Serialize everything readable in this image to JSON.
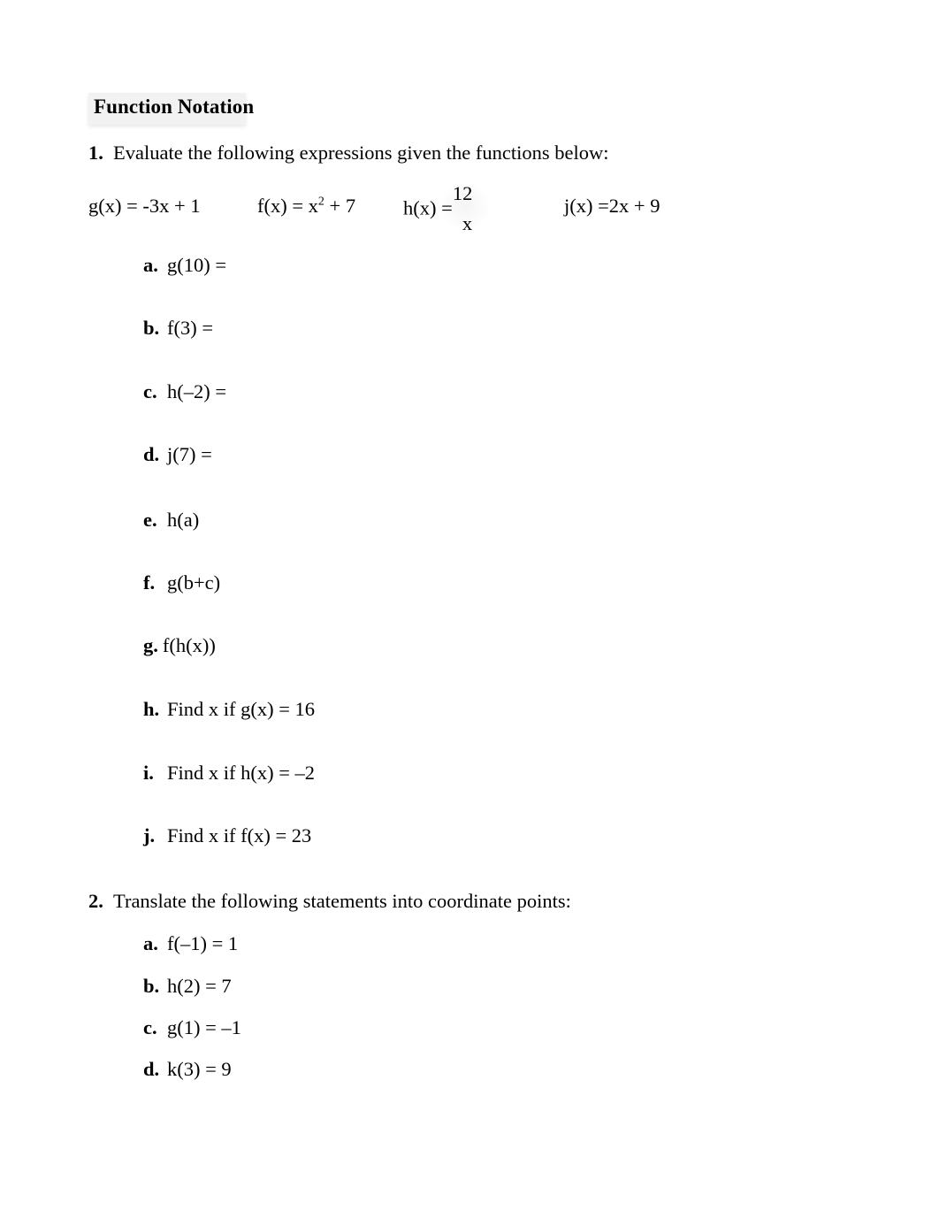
{
  "document": {
    "title": "Function Notation",
    "questions": [
      {
        "number": "1.",
        "prompt": "Evaluate the following expressions given the functions below:",
        "functions": [
          {
            "id": "g",
            "text": "g(x) = -3x + 1"
          },
          {
            "id": "f",
            "lhs": "f(x) = x",
            "exponent": "2",
            "rhs": " + 7"
          },
          {
            "id": "h",
            "lhs": "h(x) =",
            "numerator": "12",
            "denominator": "x"
          },
          {
            "id": "j",
            "text": "j(x) =2x + 9"
          }
        ],
        "items": [
          {
            "marker": "a.",
            "text": "g(10) ="
          },
          {
            "marker": "b.",
            "text": "f(3) ="
          },
          {
            "marker": "c.",
            "text": "h(–2) ="
          },
          {
            "marker": "d.",
            "text": "j(7) ="
          },
          {
            "marker": "e.",
            "text": "h(a)"
          },
          {
            "marker": "f.",
            "text": "g(b+c)"
          },
          {
            "marker": "g.",
            "text": "f(h(x))"
          },
          {
            "marker": "h.",
            "text": "Find x if g(x) = 16"
          },
          {
            "marker": "i.",
            "text": "Find x if h(x) = –2"
          },
          {
            "marker": "j.",
            "text": "Find x if f(x) = 23"
          }
        ]
      },
      {
        "number": "2.",
        "prompt": "Translate the following statements into coordinate points:",
        "items": [
          {
            "marker": "a.",
            "text": "f(–1) = 1"
          },
          {
            "marker": "b.",
            "text": "h(2) = 7"
          },
          {
            "marker": "c.",
            "text": "g(1) = –1"
          },
          {
            "marker": "d.",
            "text": "k(3) = 9"
          }
        ]
      }
    ]
  }
}
